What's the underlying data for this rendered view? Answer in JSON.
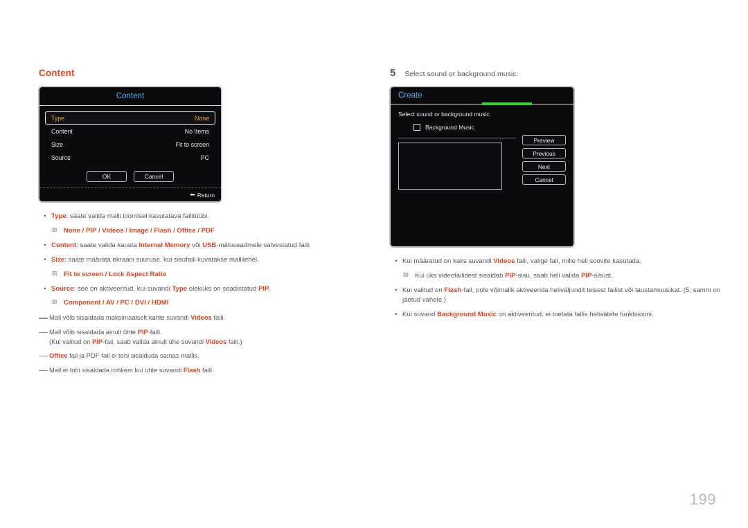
{
  "page": {
    "number": "199"
  },
  "left": {
    "heading": "Content",
    "dialog": {
      "title": "Content",
      "rows": [
        {
          "label": "Type",
          "value": "None",
          "selected": true
        },
        {
          "label": "Content",
          "value": "No Items",
          "selected": false
        },
        {
          "label": "Size",
          "value": "Fit to screen",
          "selected": false
        },
        {
          "label": "Source",
          "value": "PC",
          "selected": false
        }
      ],
      "buttons": [
        "OK",
        "Cancel"
      ],
      "footer": {
        "return_label": "Return",
        "return_icon": "return-arrow-icon"
      }
    },
    "bullets": [
      {
        "kind": "bullet",
        "marker": "•",
        "segments": [
          {
            "text": "Type",
            "style": "redb"
          },
          {
            "text": ": saate valida malli loomisel kasutatava failitüübi.",
            "style": "gray"
          }
        ]
      },
      {
        "kind": "sub",
        "marker": "☒",
        "segments": [
          {
            "text": "None",
            "style": "redb"
          },
          {
            "text": " / ",
            "style": "redb"
          },
          {
            "text": "PIP",
            "style": "redb"
          },
          {
            "text": " / ",
            "style": "redb"
          },
          {
            "text": "Videos",
            "style": "redb"
          },
          {
            "text": " / ",
            "style": "redb"
          },
          {
            "text": "Image",
            "style": "redb"
          },
          {
            "text": " / ",
            "style": "redb"
          },
          {
            "text": "Flash",
            "style": "redb"
          },
          {
            "text": " / ",
            "style": "redb"
          },
          {
            "text": "Office",
            "style": "redb"
          },
          {
            "text": " / ",
            "style": "redb"
          },
          {
            "text": "PDF",
            "style": "redb"
          }
        ]
      },
      {
        "kind": "bullet",
        "marker": "•",
        "segments": [
          {
            "text": "Content",
            "style": "redb"
          },
          {
            "text": ": saate valida kausta ",
            "style": "gray"
          },
          {
            "text": "Internal Memory",
            "style": "redb"
          },
          {
            "text": " või ",
            "style": "gray"
          },
          {
            "text": "USB",
            "style": "redb"
          },
          {
            "text": "-mäluseadmele salvestatud faili.",
            "style": "gray"
          }
        ]
      },
      {
        "kind": "bullet",
        "marker": "•",
        "segments": [
          {
            "text": "Size",
            "style": "redb"
          },
          {
            "text": ": saate määrata ekraani suuruse, kui sisufaili kuvatakse mallilehel.",
            "style": "gray"
          }
        ]
      },
      {
        "kind": "sub",
        "marker": "☒",
        "segments": [
          {
            "text": "Fit to screen",
            "style": "redb"
          },
          {
            "text": " / ",
            "style": "redb"
          },
          {
            "text": "Lock Aspect Ratio",
            "style": "redb"
          }
        ]
      },
      {
        "kind": "bullet",
        "marker": "•",
        "segments": [
          {
            "text": "Source",
            "style": "redb"
          },
          {
            "text": ": see on aktiveeritud, kui suvandi ",
            "style": "gray"
          },
          {
            "text": "Type",
            "style": "redb"
          },
          {
            "text": " olekuks on seadistatud ",
            "style": "gray"
          },
          {
            "text": "PIP",
            "style": "redb"
          },
          {
            "text": ".",
            "style": "redb"
          }
        ]
      },
      {
        "kind": "sub",
        "marker": "☒",
        "segments": [
          {
            "text": "Component",
            "style": "redb"
          },
          {
            "text": " / ",
            "style": "redb"
          },
          {
            "text": "AV",
            "style": "redb"
          },
          {
            "text": " / ",
            "style": "redb"
          },
          {
            "text": "PC",
            "style": "redb"
          },
          {
            "text": " / ",
            "style": "redb"
          },
          {
            "text": "DVI",
            "style": "redb"
          },
          {
            "text": " / ",
            "style": "redb"
          },
          {
            "text": "HDMI",
            "style": "redb"
          }
        ]
      }
    ],
    "notes": [
      {
        "segments": [
          {
            "text": "Mall võib sisaldada maksimaalselt kahte suvandi ",
            "style": "gray"
          },
          {
            "text": "Videos",
            "style": "redb"
          },
          {
            "text": " faili.",
            "style": "gray"
          }
        ]
      },
      {
        "segments": [
          {
            "text": "Mall võib sisaldada ainult ühte ",
            "style": "gray"
          },
          {
            "text": "PIP",
            "style": "redb"
          },
          {
            "text": "-faili.",
            "style": "gray"
          },
          {
            "text": "\n",
            "style": "gray"
          },
          {
            "text": " (Kui valitud on ",
            "style": "gray"
          },
          {
            "text": "PIP",
            "style": "redb"
          },
          {
            "text": "-fail, saab valida ainult ühe suvandi ",
            "style": "gray"
          },
          {
            "text": "Videos",
            "style": "redb"
          },
          {
            "text": " faili.)",
            "style": "gray"
          }
        ]
      },
      {
        "segments": [
          {
            "text": "Office",
            "style": "redb"
          },
          {
            "text": " fail ja PDF-fail ei tohi sisalduda samas mallis.",
            "style": "gray"
          }
        ]
      },
      {
        "segments": [
          {
            "text": "Mall ei tohi sisaldada rohkem kui ühte suvandi ",
            "style": "gray"
          },
          {
            "text": "Flash",
            "style": "redb"
          },
          {
            "text": " faili.",
            "style": "gray"
          }
        ]
      }
    ]
  },
  "right": {
    "step": {
      "number": "5",
      "text": "Select sound or background music."
    },
    "dialog": {
      "title": "Create",
      "instruction": "Select sound or background music.",
      "checkbox": {
        "label": "Background Music",
        "checked": false
      },
      "buttons": [
        "Preview",
        "Previous",
        "Next",
        "Cancel"
      ],
      "progress_color": "#2bd32b"
    },
    "bullets": [
      {
        "kind": "bullet",
        "marker": "•",
        "segments": [
          {
            "text": "Kui määratud on kaks suvandi ",
            "style": "gray"
          },
          {
            "text": "Videos",
            "style": "redb"
          },
          {
            "text": " faili, valige fail, mille heli soovite kasutada.",
            "style": "gray"
          }
        ]
      },
      {
        "kind": "sub",
        "marker": "☒",
        "segments": [
          {
            "text": "Kui üks videofailidest sisaldab ",
            "style": "gray"
          },
          {
            "text": "PIP",
            "style": "redb"
          },
          {
            "text": "-sisu, saab heli valida ",
            "style": "gray"
          },
          {
            "text": "PIP",
            "style": "redb"
          },
          {
            "text": "-sisust.",
            "style": "gray"
          }
        ]
      },
      {
        "kind": "bullet",
        "marker": "•",
        "segments": [
          {
            "text": "Kui valitud on ",
            "style": "gray"
          },
          {
            "text": "Flash",
            "style": "redb"
          },
          {
            "text": "-fail, pole võimalik aktiveerida heliväljundit teisest failist või taustamuusikat. (5. samm on jäetud vahele.)",
            "style": "gray"
          }
        ]
      },
      {
        "kind": "bullet",
        "marker": "•",
        "segments": [
          {
            "text": "Kui suvand ",
            "style": "gray"
          },
          {
            "text": "Background Music",
            "style": "redb"
          },
          {
            "text": " on aktiveeritud, ei toetata failis helisätete funktsiooni.",
            "style": "gray"
          }
        ]
      }
    ]
  }
}
